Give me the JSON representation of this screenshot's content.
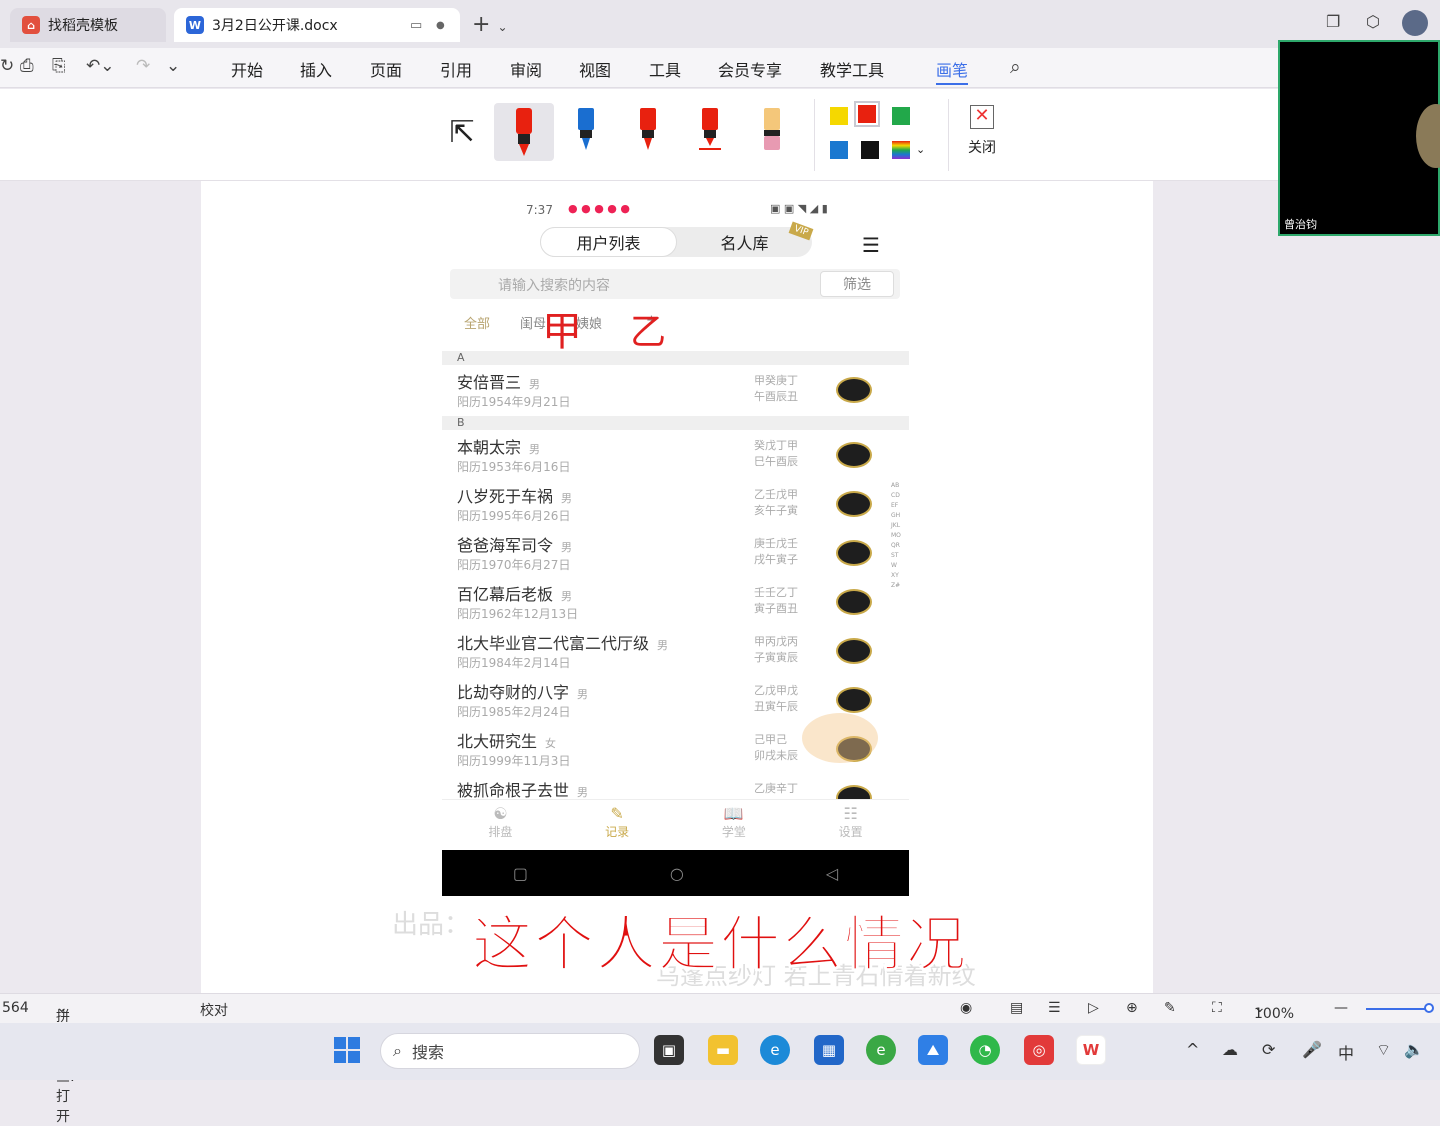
{
  "tabs": [
    {
      "icon": "wps-red-icon",
      "label": "找稻壳模板"
    },
    {
      "icon": "word-doc-icon",
      "label": "3月2日公开课.docx"
    }
  ],
  "menu": [
    "开始",
    "插入",
    "页面",
    "引用",
    "审阅",
    "视图",
    "工具",
    "会员专享",
    "教学工具",
    "画笔"
  ],
  "active_menu": "画笔",
  "pen_toolbar": {
    "close_label": "关闭",
    "colors": [
      "#f5d800",
      "#e8210f",
      "#22a84a",
      "#1a78d0",
      "#111111"
    ]
  },
  "video": {
    "name": "曾治钧"
  },
  "phone": {
    "time": "7:37",
    "segments": [
      "用户列表",
      "名人库"
    ],
    "vip": "VIP",
    "search_placeholder": "请输入搜索的内容",
    "filter": "筛选",
    "categories": [
      "全部",
      "闺母",
      "姨娘",
      "+"
    ],
    "handwriting": [
      "甲",
      "乙"
    ],
    "sections": [
      {
        "letter": "A",
        "rows": [
          {
            "name": "安倍晋三",
            "gender": "男",
            "date": "阳历1954年9月21日",
            "bazi1": "甲癸庚丁",
            "bazi2": "午酉辰丑"
          }
        ]
      },
      {
        "letter": "B",
        "rows": [
          {
            "name": "本朝太宗",
            "gender": "男",
            "date": "阳历1953年6月16日",
            "bazi1": "癸戊丁甲",
            "bazi2": "巳午酉辰"
          },
          {
            "name": "八岁死于车祸",
            "gender": "男",
            "date": "阳历1995年6月26日",
            "bazi1": "乙壬戊甲",
            "bazi2": "亥午子寅"
          },
          {
            "name": "爸爸海军司令",
            "gender": "男",
            "date": "阳历1970年6月27日",
            "bazi1": "庚壬戊壬",
            "bazi2": "戌午寅子"
          },
          {
            "name": "百亿幕后老板",
            "gender": "男",
            "date": "阳历1962年12月13日",
            "bazi1": "壬壬乙丁",
            "bazi2": "寅子酉丑"
          },
          {
            "name": "北大毕业官二代富二代厅级",
            "gender": "男",
            "date": "阳历1984年2月14日",
            "bazi1": "甲丙戊丙",
            "bazi2": "子寅寅辰"
          },
          {
            "name": "比劫夺财的八字",
            "gender": "男",
            "date": "阳历1985年2月24日",
            "bazi1": "乙戊甲戊",
            "bazi2": "丑寅午辰"
          },
          {
            "name": "北大研究生",
            "gender": "女",
            "date": "阳历1999年11月3日",
            "bazi1": "己甲己",
            "bazi2": "卯戌未辰"
          },
          {
            "name": "被抓命根子去世",
            "gender": "男",
            "date": "",
            "bazi1": "乙庚辛丁",
            "bazi2": ""
          }
        ]
      }
    ],
    "alphabet": "ABCDEFGHJKLMOQRSTWXYZ#",
    "bottom_nav": [
      "排盘",
      "记录",
      "学堂",
      "设置"
    ],
    "active_nav": "记录"
  },
  "caption": "这个人是什么情况",
  "watermark1": "出品：",
  "watermark2": "乌蓬点纱灯  若上青石情着新纹",
  "statusbar": {
    "count": "564",
    "spell": "拼写检查: 打开",
    "proof": "校对",
    "zoom": "100%"
  },
  "taskbar": {
    "search": "搜索",
    "ime": "中"
  }
}
